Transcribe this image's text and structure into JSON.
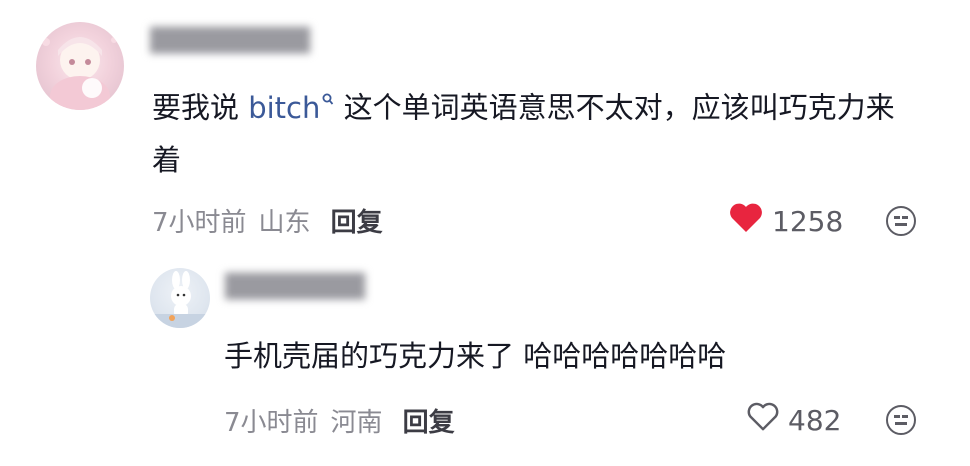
{
  "comments": [
    {
      "username": "▇▇▇▇▇▇▇▇",
      "text_before": "要我说 ",
      "link_word": "bitch",
      "text_after": " 这个单词英语意思不太对，应该叫巧克力来着",
      "time": "7小时前",
      "location": "山东",
      "reply_label": "回复",
      "likes": "1258",
      "liked": true
    }
  ],
  "reply": {
    "username": "▇▇▇▇▇▇▇",
    "text": "手机壳届的巧克力来了 哈哈哈哈哈哈哈",
    "time": "7小时前",
    "location": "河南",
    "reply_label": "回复",
    "likes": "482",
    "liked": false
  },
  "icons": {
    "heart_filled": "heart-filled-icon",
    "heart_outline": "heart-outline-icon",
    "emoji": "neutral-face-icon",
    "search": "search-icon"
  },
  "colors": {
    "like_red": "#e8253f",
    "link_blue": "#3b5998",
    "meta_gray": "#8a8a92"
  }
}
